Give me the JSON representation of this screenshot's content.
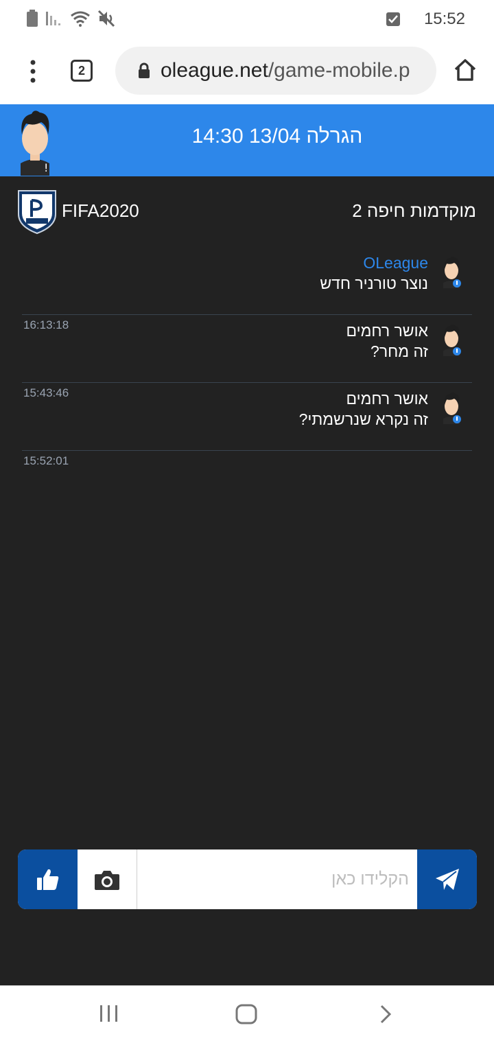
{
  "status_bar": {
    "time": "15:52",
    "icons": [
      "battery-icon",
      "signal-icon",
      "wifi-icon",
      "mute-icon",
      "checkbox-notification-icon"
    ]
  },
  "browser": {
    "tab_count": "2",
    "url_domain": "oleague.net",
    "url_path": "/game-mobile.p"
  },
  "header": {
    "title": "הגרלה 13/04 14:30"
  },
  "tournament": {
    "game": "FIFA2020",
    "name": "מוקדמות חיפה 2"
  },
  "messages": [
    {
      "author": "OLeague",
      "text": "נוצר טורניר חדש",
      "time": "16:13:18",
      "brand": true
    },
    {
      "author": "אושר רחמים",
      "text": "זה מחר?",
      "time": "15:43:46",
      "brand": false
    },
    {
      "author": "אושר רחמים",
      "text": "זה נקרא שנרשמתי?",
      "time": "15:52:01",
      "brand": false
    }
  ],
  "input": {
    "placeholder": "הקלידו כאן"
  },
  "colors": {
    "brand_blue": "#2d87ea",
    "button_blue": "#0b4f9f",
    "background": "#222222"
  }
}
